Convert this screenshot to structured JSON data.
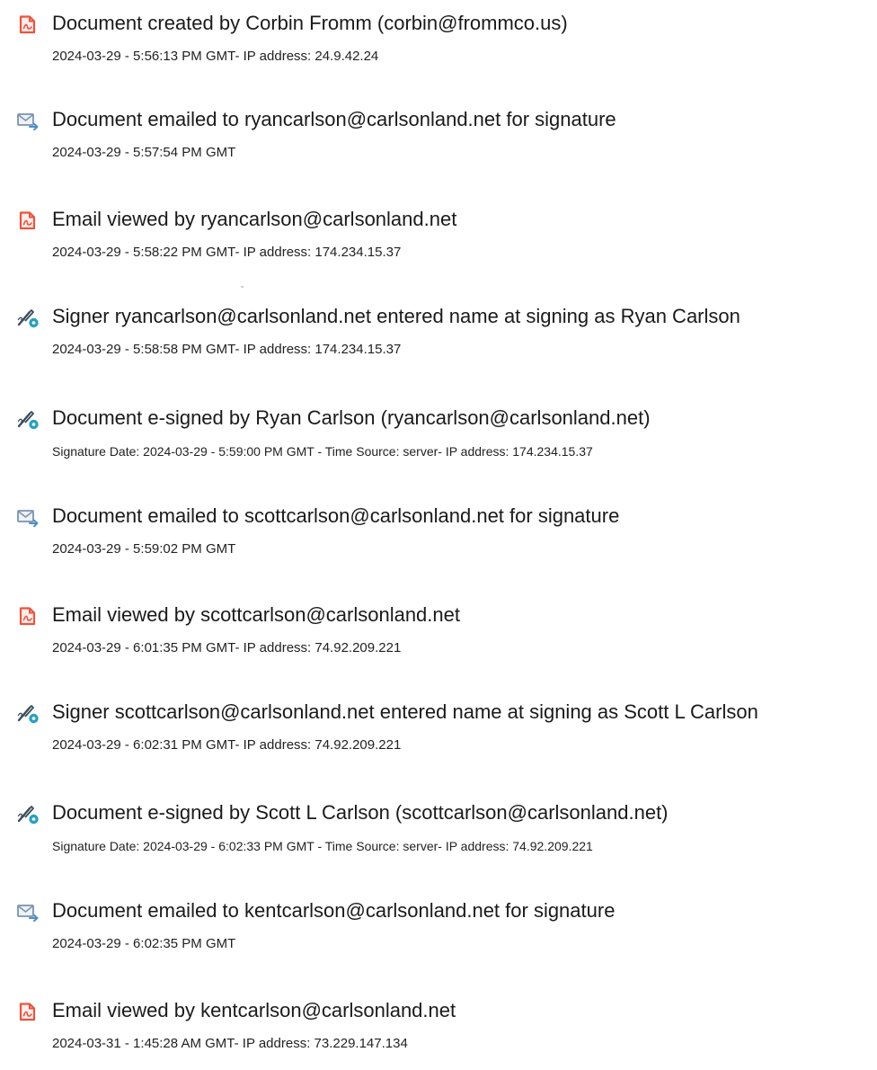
{
  "colors": {
    "pdf_icon": "#e8553f",
    "email_icon": "#7b93ad",
    "sign_icon": "#3a4d5c",
    "sign_badge": "#2a9fc0",
    "text": "#1a1a1a"
  },
  "events": [
    {
      "icon": "pdf-document-icon",
      "title": "Document created by Corbin Fromm (corbin@frommco.us)",
      "detail": "2024-03-29 - 5:56:13 PM GMT- IP address: 24.9.42.24"
    },
    {
      "icon": "email-sent-icon",
      "title": "Document emailed to ryancarlson@carlsonland.net for signature",
      "detail": "2024-03-29 - 5:57:54 PM GMT"
    },
    {
      "icon": "pdf-document-icon",
      "title": "Email viewed by ryancarlson@carlsonland.net",
      "detail": "2024-03-29 - 5:58:22 PM GMT- IP address: 174.234.15.37"
    },
    {
      "icon": "signature-pen-icon",
      "title": "Signer ryancarlson@carlsonland.net entered name at signing as Ryan Carlson",
      "detail": "2024-03-29 - 5:58:58 PM GMT- IP address: 174.234.15.37"
    },
    {
      "icon": "signature-pen-icon",
      "title": "Document e-signed by Ryan Carlson (ryancarlson@carlsonland.net)",
      "detail": "Signature Date: 2024-03-29 - 5:59:00 PM GMT - Time Source: server- IP address: 174.234.15.37"
    },
    {
      "icon": "email-sent-icon",
      "title": "Document emailed to scottcarlson@carlsonland.net for signature",
      "detail": "2024-03-29 - 5:59:02 PM GMT"
    },
    {
      "icon": "pdf-document-icon",
      "title": "Email viewed by scottcarlson@carlsonland.net",
      "detail": "2024-03-29 - 6:01:35 PM GMT- IP address: 74.92.209.221"
    },
    {
      "icon": "signature-pen-icon",
      "title": "Signer scottcarlson@carlsonland.net entered name at signing as Scott L Carlson",
      "detail": "2024-03-29 - 6:02:31 PM GMT- IP address: 74.92.209.221"
    },
    {
      "icon": "signature-pen-icon",
      "title": "Document e-signed by Scott L Carlson (scottcarlson@carlsonland.net)",
      "detail": "Signature Date: 2024-03-29 - 6:02:33 PM GMT - Time Source: server- IP address: 74.92.209.221"
    },
    {
      "icon": "email-sent-icon",
      "title": "Document emailed to kentcarlson@carlsonland.net for signature",
      "detail": "2024-03-29 - 6:02:35 PM GMT"
    },
    {
      "icon": "pdf-document-icon",
      "title": "Email viewed by kentcarlson@carlsonland.net",
      "detail": "2024-03-31 - 1:45:28 AM GMT- IP address: 73.229.147.134"
    }
  ]
}
